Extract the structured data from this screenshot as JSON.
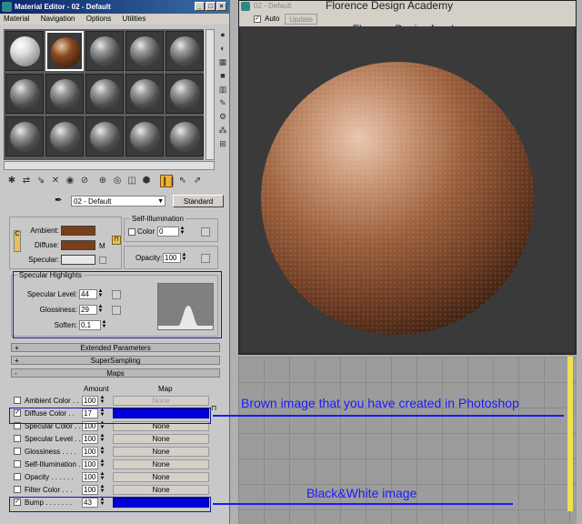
{
  "editor": {
    "title": "Material Editor - 02 - Default",
    "menu": [
      "Material",
      "Navigation",
      "Options",
      "Utilities"
    ],
    "material_name": "02 - Default",
    "material_type": "Standard"
  },
  "basic": {
    "ambient_label": "Ambient:",
    "diffuse_label": "Diffuse:",
    "specular_label": "Specular:",
    "lock_c": "C",
    "m_label": "M",
    "ambient_color": "#7a3f1a",
    "diffuse_color": "#7a3f1a",
    "specular_color": "#e8e8e8",
    "self_illum_title": "Self-Illumination",
    "color_label": "Color",
    "color_value": "0",
    "opacity_label": "Opacity:",
    "opacity_value": "100"
  },
  "specular": {
    "title": "Specular Highlights",
    "level_label": "Specular Level:",
    "level_value": "44",
    "gloss_label": "Glossiness:",
    "gloss_value": "29",
    "soften_label": "Soften:",
    "soften_value": "0,1"
  },
  "rollouts": {
    "extended": "Extended Parameters",
    "supersampling": "SuperSampling",
    "maps": "Maps",
    "plus": "+",
    "minus": "-"
  },
  "maps": {
    "amount_header": "Amount",
    "map_header": "Map",
    "none": "None",
    "rows": [
      {
        "label": "Ambient Color . .",
        "amount": "100",
        "map": "None",
        "checked": false
      },
      {
        "label": "Diffuse Color . .",
        "amount": "17",
        "map": "",
        "checked": true
      },
      {
        "label": "Specular Color . .",
        "amount": "100",
        "map": "None",
        "checked": false
      },
      {
        "label": "Specular Level . .",
        "amount": "100",
        "map": "None",
        "checked": false
      },
      {
        "label": "Glossiness . . . .",
        "amount": "100",
        "map": "None",
        "checked": false
      },
      {
        "label": "Self-Illumination .",
        "amount": "100",
        "map": "None",
        "checked": false
      },
      {
        "label": "Opacity . . . . . .",
        "amount": "100",
        "map": "None",
        "checked": false
      },
      {
        "label": "Filter Color . . .",
        "amount": "100",
        "map": "None",
        "checked": false
      },
      {
        "label": "Bump . . . . . . .",
        "amount": "43",
        "map": "",
        "checked": true
      }
    ]
  },
  "viewport": {
    "title": "02 - Default",
    "auto_label": "Auto",
    "update_label": "Update",
    "watermark": "Florence Design Academy",
    "website": "www.FlorenceDesignAcademy.com"
  },
  "annotations": {
    "brown": "Brown  image that you have created in Photoshop",
    "bw": "Black&White image"
  },
  "check_mark": "✓"
}
